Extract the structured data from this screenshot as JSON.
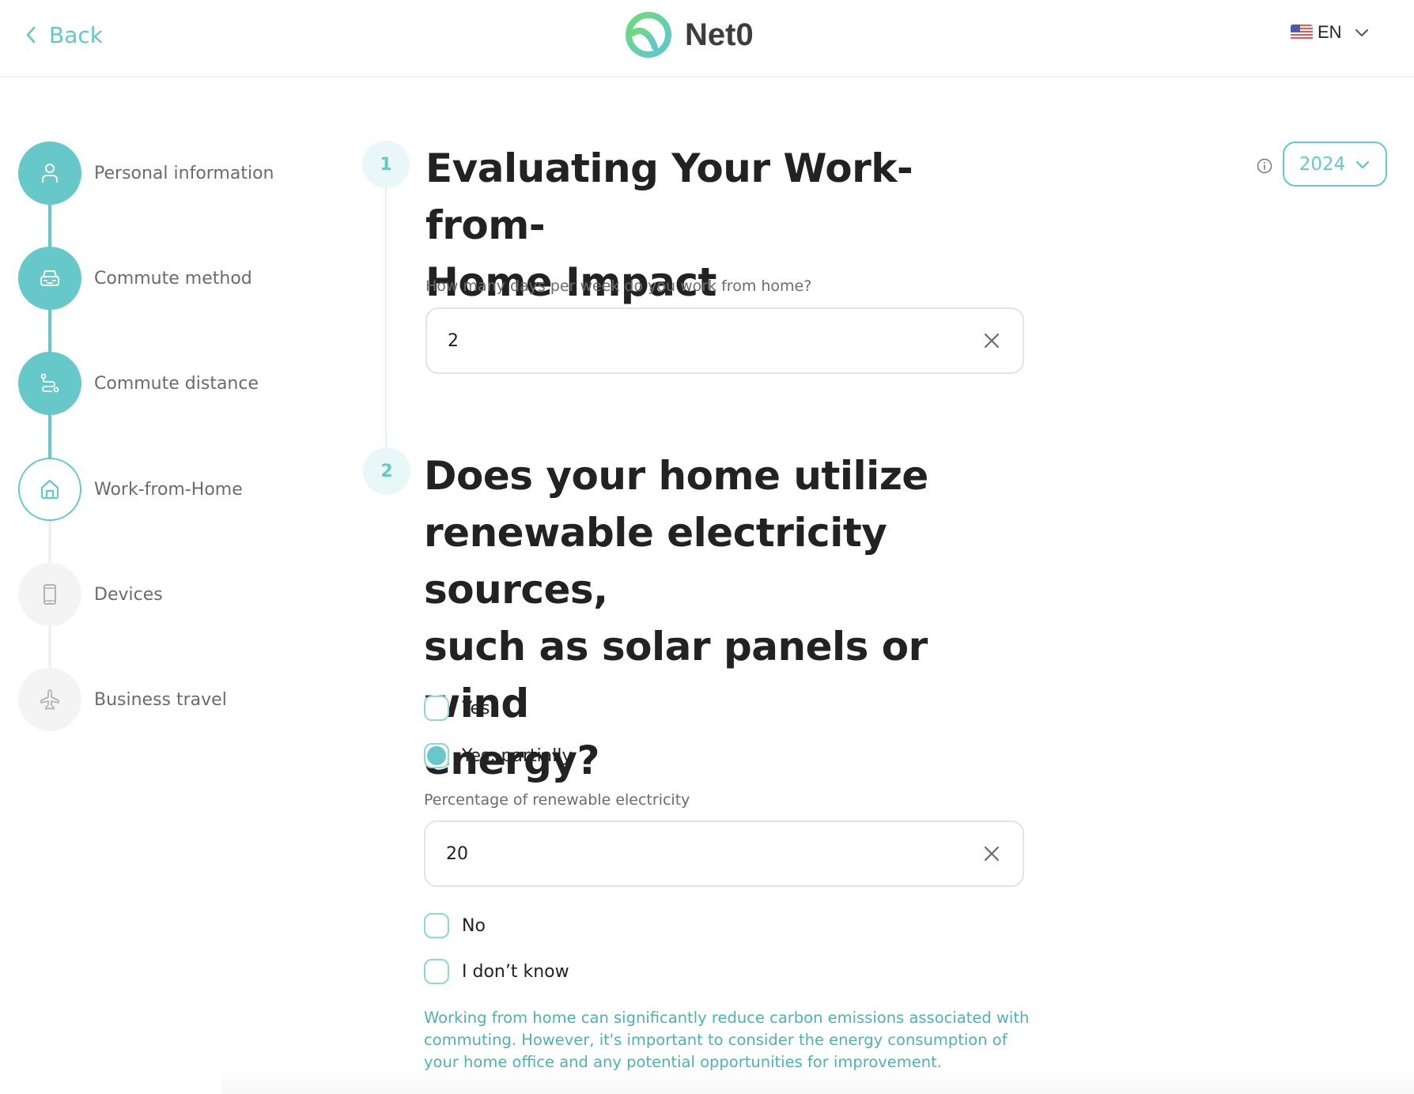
{
  "header": {
    "back_label": "Back",
    "brand_name": "Net0",
    "language": {
      "code": "EN",
      "flag": "us-flag-icon"
    }
  },
  "colors": {
    "accent": "#66c8c9",
    "accent_light": "#eaf7f8",
    "text_dark": "#222222",
    "text_muted": "#6b6b6b",
    "info_text": "#4fb1b3"
  },
  "sidebar": {
    "steps": [
      {
        "label": "Personal information",
        "icon": "person-icon",
        "status": "completed"
      },
      {
        "label": "Commute method",
        "icon": "car-icon",
        "status": "completed"
      },
      {
        "label": "Commute distance",
        "icon": "route-icon",
        "status": "completed"
      },
      {
        "label": "Work-from-Home",
        "icon": "home-icon",
        "status": "current"
      },
      {
        "label": "Devices",
        "icon": "phone-icon",
        "status": "upcoming"
      },
      {
        "label": "Business travel",
        "icon": "airplane-icon",
        "status": "upcoming"
      }
    ]
  },
  "year_selector": {
    "value": "2024"
  },
  "questions": [
    {
      "number": "1",
      "title_line1": "Evaluating Your Work-from-",
      "title_line2": "Home Impact",
      "field_label": "How many days per week do you work from home?",
      "value": "2"
    },
    {
      "number": "2",
      "title_lines": [
        "Does your home utilize",
        "renewable electricity sources,",
        "such as solar panels or wind",
        "energy?"
      ],
      "options": [
        {
          "label": "Yes",
          "selected": false
        },
        {
          "label": "Yes, partially",
          "selected": true
        },
        {
          "label": "No",
          "selected": false
        },
        {
          "label": "I don’t know",
          "selected": false
        }
      ],
      "sub_field": {
        "label": "Percentage of renewable electricity",
        "value": "20"
      },
      "info_text": "Working from home can significantly reduce carbon emissions associated with commuting. However, it's important to consider the energy consumption of your home office and any potential opportunities for improvement."
    }
  ]
}
